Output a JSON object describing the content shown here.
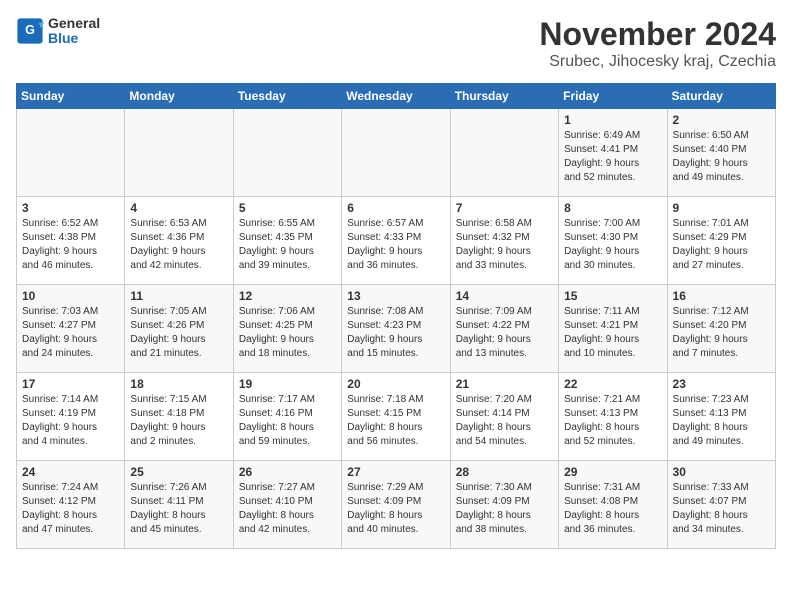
{
  "logo": {
    "line1": "General",
    "line2": "Blue"
  },
  "title": "November 2024",
  "subtitle": "Srubec, Jihocesky kraj, Czechia",
  "weekdays": [
    "Sunday",
    "Monday",
    "Tuesday",
    "Wednesday",
    "Thursday",
    "Friday",
    "Saturday"
  ],
  "weeks": [
    [
      {
        "day": "",
        "info": ""
      },
      {
        "day": "",
        "info": ""
      },
      {
        "day": "",
        "info": ""
      },
      {
        "day": "",
        "info": ""
      },
      {
        "day": "",
        "info": ""
      },
      {
        "day": "1",
        "info": "Sunrise: 6:49 AM\nSunset: 4:41 PM\nDaylight: 9 hours\nand 52 minutes."
      },
      {
        "day": "2",
        "info": "Sunrise: 6:50 AM\nSunset: 4:40 PM\nDaylight: 9 hours\nand 49 minutes."
      }
    ],
    [
      {
        "day": "3",
        "info": "Sunrise: 6:52 AM\nSunset: 4:38 PM\nDaylight: 9 hours\nand 46 minutes."
      },
      {
        "day": "4",
        "info": "Sunrise: 6:53 AM\nSunset: 4:36 PM\nDaylight: 9 hours\nand 42 minutes."
      },
      {
        "day": "5",
        "info": "Sunrise: 6:55 AM\nSunset: 4:35 PM\nDaylight: 9 hours\nand 39 minutes."
      },
      {
        "day": "6",
        "info": "Sunrise: 6:57 AM\nSunset: 4:33 PM\nDaylight: 9 hours\nand 36 minutes."
      },
      {
        "day": "7",
        "info": "Sunrise: 6:58 AM\nSunset: 4:32 PM\nDaylight: 9 hours\nand 33 minutes."
      },
      {
        "day": "8",
        "info": "Sunrise: 7:00 AM\nSunset: 4:30 PM\nDaylight: 9 hours\nand 30 minutes."
      },
      {
        "day": "9",
        "info": "Sunrise: 7:01 AM\nSunset: 4:29 PM\nDaylight: 9 hours\nand 27 minutes."
      }
    ],
    [
      {
        "day": "10",
        "info": "Sunrise: 7:03 AM\nSunset: 4:27 PM\nDaylight: 9 hours\nand 24 minutes."
      },
      {
        "day": "11",
        "info": "Sunrise: 7:05 AM\nSunset: 4:26 PM\nDaylight: 9 hours\nand 21 minutes."
      },
      {
        "day": "12",
        "info": "Sunrise: 7:06 AM\nSunset: 4:25 PM\nDaylight: 9 hours\nand 18 minutes."
      },
      {
        "day": "13",
        "info": "Sunrise: 7:08 AM\nSunset: 4:23 PM\nDaylight: 9 hours\nand 15 minutes."
      },
      {
        "day": "14",
        "info": "Sunrise: 7:09 AM\nSunset: 4:22 PM\nDaylight: 9 hours\nand 13 minutes."
      },
      {
        "day": "15",
        "info": "Sunrise: 7:11 AM\nSunset: 4:21 PM\nDaylight: 9 hours\nand 10 minutes."
      },
      {
        "day": "16",
        "info": "Sunrise: 7:12 AM\nSunset: 4:20 PM\nDaylight: 9 hours\nand 7 minutes."
      }
    ],
    [
      {
        "day": "17",
        "info": "Sunrise: 7:14 AM\nSunset: 4:19 PM\nDaylight: 9 hours\nand 4 minutes."
      },
      {
        "day": "18",
        "info": "Sunrise: 7:15 AM\nSunset: 4:18 PM\nDaylight: 9 hours\nand 2 minutes."
      },
      {
        "day": "19",
        "info": "Sunrise: 7:17 AM\nSunset: 4:16 PM\nDaylight: 8 hours\nand 59 minutes."
      },
      {
        "day": "20",
        "info": "Sunrise: 7:18 AM\nSunset: 4:15 PM\nDaylight: 8 hours\nand 56 minutes."
      },
      {
        "day": "21",
        "info": "Sunrise: 7:20 AM\nSunset: 4:14 PM\nDaylight: 8 hours\nand 54 minutes."
      },
      {
        "day": "22",
        "info": "Sunrise: 7:21 AM\nSunset: 4:13 PM\nDaylight: 8 hours\nand 52 minutes."
      },
      {
        "day": "23",
        "info": "Sunrise: 7:23 AM\nSunset: 4:13 PM\nDaylight: 8 hours\nand 49 minutes."
      }
    ],
    [
      {
        "day": "24",
        "info": "Sunrise: 7:24 AM\nSunset: 4:12 PM\nDaylight: 8 hours\nand 47 minutes."
      },
      {
        "day": "25",
        "info": "Sunrise: 7:26 AM\nSunset: 4:11 PM\nDaylight: 8 hours\nand 45 minutes."
      },
      {
        "day": "26",
        "info": "Sunrise: 7:27 AM\nSunset: 4:10 PM\nDaylight: 8 hours\nand 42 minutes."
      },
      {
        "day": "27",
        "info": "Sunrise: 7:29 AM\nSunset: 4:09 PM\nDaylight: 8 hours\nand 40 minutes."
      },
      {
        "day": "28",
        "info": "Sunrise: 7:30 AM\nSunset: 4:09 PM\nDaylight: 8 hours\nand 38 minutes."
      },
      {
        "day": "29",
        "info": "Sunrise: 7:31 AM\nSunset: 4:08 PM\nDaylight: 8 hours\nand 36 minutes."
      },
      {
        "day": "30",
        "info": "Sunrise: 7:33 AM\nSunset: 4:07 PM\nDaylight: 8 hours\nand 34 minutes."
      }
    ]
  ]
}
